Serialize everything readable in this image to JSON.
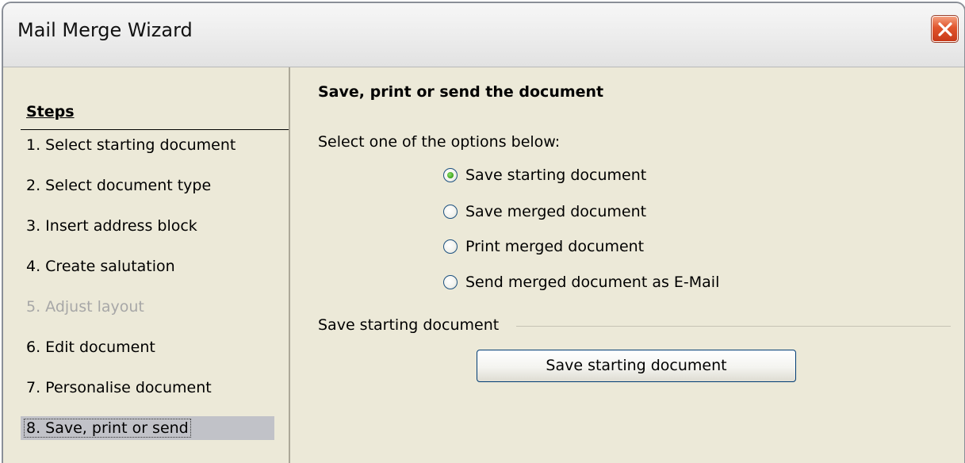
{
  "window": {
    "title": "Mail Merge Wizard",
    "close_icon": "close-icon"
  },
  "sidebar": {
    "title": "Steps",
    "items": [
      {
        "label": "1.  Select starting document",
        "state": "enabled"
      },
      {
        "label": "2.  Select document type",
        "state": "enabled"
      },
      {
        "label": "3.  Insert address block",
        "state": "enabled"
      },
      {
        "label": "4.  Create salutation",
        "state": "enabled"
      },
      {
        "label": "5.  Adjust layout",
        "state": "disabled"
      },
      {
        "label": "6.  Edit document",
        "state": "enabled"
      },
      {
        "label": "7.  Personalise document",
        "state": "enabled"
      },
      {
        "label": "8.  Save, print or send",
        "state": "selected"
      }
    ]
  },
  "main": {
    "title": "Save, print or send the document",
    "prompt": "Select one of the options below:",
    "options": [
      {
        "label": "Save starting document",
        "checked": true
      },
      {
        "label": "Save merged document",
        "checked": false
      },
      {
        "label": "Print merged document",
        "checked": false
      },
      {
        "label": "Send merged document as E-Mail",
        "checked": false
      }
    ],
    "section_label": "Save starting document",
    "action_button_label": "Save starting document"
  },
  "colors": {
    "dialog_background": "#ece9d8",
    "selected_step_background": "#c1c2c8",
    "disabled_text": "#a7a7a7",
    "radio_checked": "#3aa11a",
    "close_button": "#e0542c"
  }
}
